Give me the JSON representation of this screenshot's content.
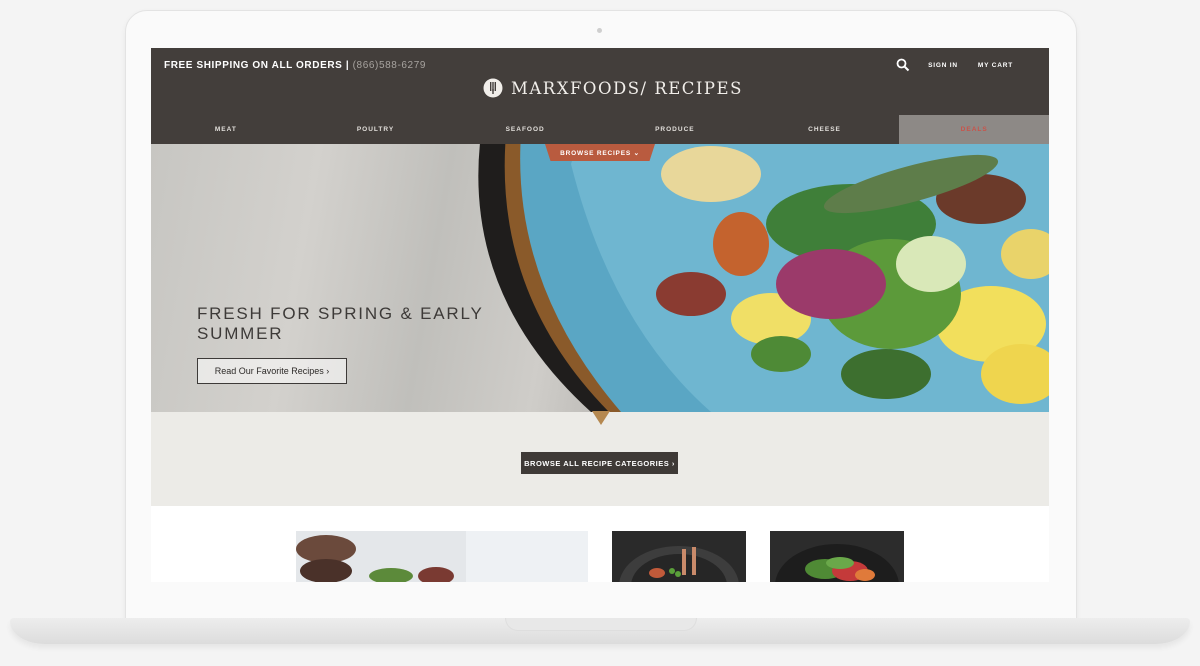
{
  "header": {
    "shipping": "FREE SHIPPING ON ALL ORDERS | ",
    "phone": "(866)588-6279",
    "sign_in": "SIGN IN",
    "cart": "MY CART",
    "logo": "MARXFOODS/ RECIPES"
  },
  "nav": {
    "items": [
      "MEAT",
      "POULTRY",
      "SEAFOOD",
      "PRODUCE",
      "CHEESE",
      "DEALS"
    ]
  },
  "hero": {
    "browse_tab": "BROWSE RECIPES ⌄",
    "title": "FRESH FOR SPRING & EARLY SUMMER",
    "cta": "Read Our Favorite Recipes ›"
  },
  "band": {
    "button": "BROWSE ALL RECIPE CATEGORIES ›"
  },
  "icons": {
    "search": "search-icon",
    "logo": "fork-logo-icon"
  },
  "colors": {
    "header_bg": "#433e3b",
    "deals_bg": "#8d8986",
    "deals_text": "#c9534a",
    "accent": "#b95b3f",
    "band_bg": "#ecebe7"
  }
}
